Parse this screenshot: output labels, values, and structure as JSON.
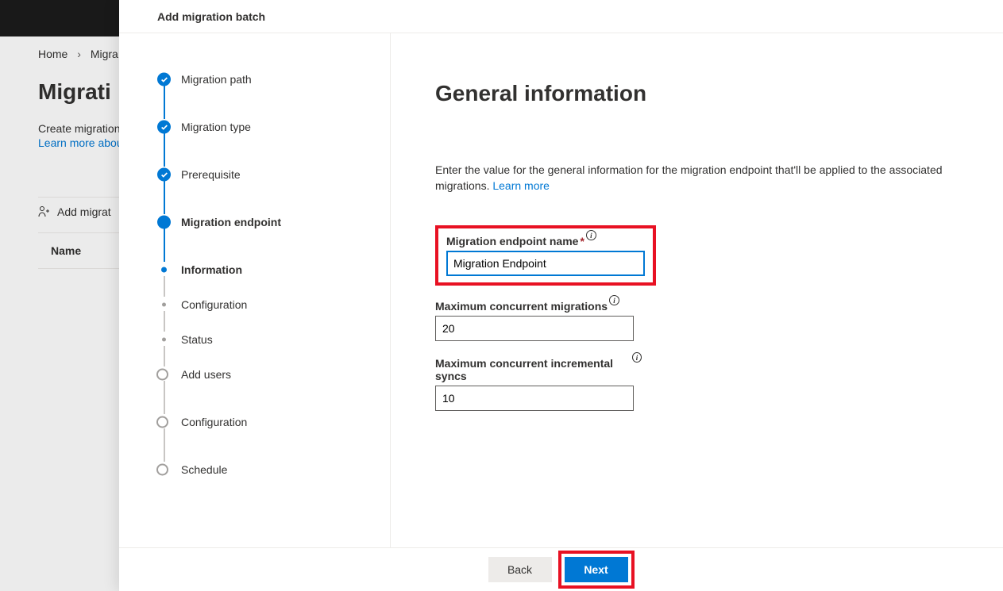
{
  "background": {
    "breadcrumb": {
      "home": "Home",
      "current": "Migra"
    },
    "title": "Migrati",
    "description": "Create migration",
    "learn_more": "Learn more abou",
    "add_button": "Add migrat",
    "table_header_name": "Name"
  },
  "wizard": {
    "title": "Add migration batch",
    "steps": [
      {
        "label": "Migration path",
        "state": "completed"
      },
      {
        "label": "Migration type",
        "state": "completed"
      },
      {
        "label": "Prerequisite",
        "state": "completed"
      },
      {
        "label": "Migration endpoint",
        "state": "current"
      },
      {
        "label": "Information",
        "state": "minor-current"
      },
      {
        "label": "Configuration",
        "state": "minor-upcoming"
      },
      {
        "label": "Status",
        "state": "minor-upcoming"
      },
      {
        "label": "Add users",
        "state": "upcoming"
      },
      {
        "label": "Configuration",
        "state": "upcoming"
      },
      {
        "label": "Schedule",
        "state": "upcoming"
      }
    ],
    "form": {
      "heading": "General information",
      "description": "Enter the value for the general information for the migration endpoint that'll be applied to the associated migrations.",
      "learn_more": "Learn more",
      "fields": {
        "endpoint_name": {
          "label": "Migration endpoint name",
          "value": "Migration Endpoint"
        },
        "max_migrations": {
          "label": "Maximum concurrent migrations",
          "value": "20"
        },
        "max_syncs": {
          "label": "Maximum concurrent incremental syncs",
          "value": "10"
        }
      }
    },
    "buttons": {
      "back": "Back",
      "next": "Next"
    }
  }
}
